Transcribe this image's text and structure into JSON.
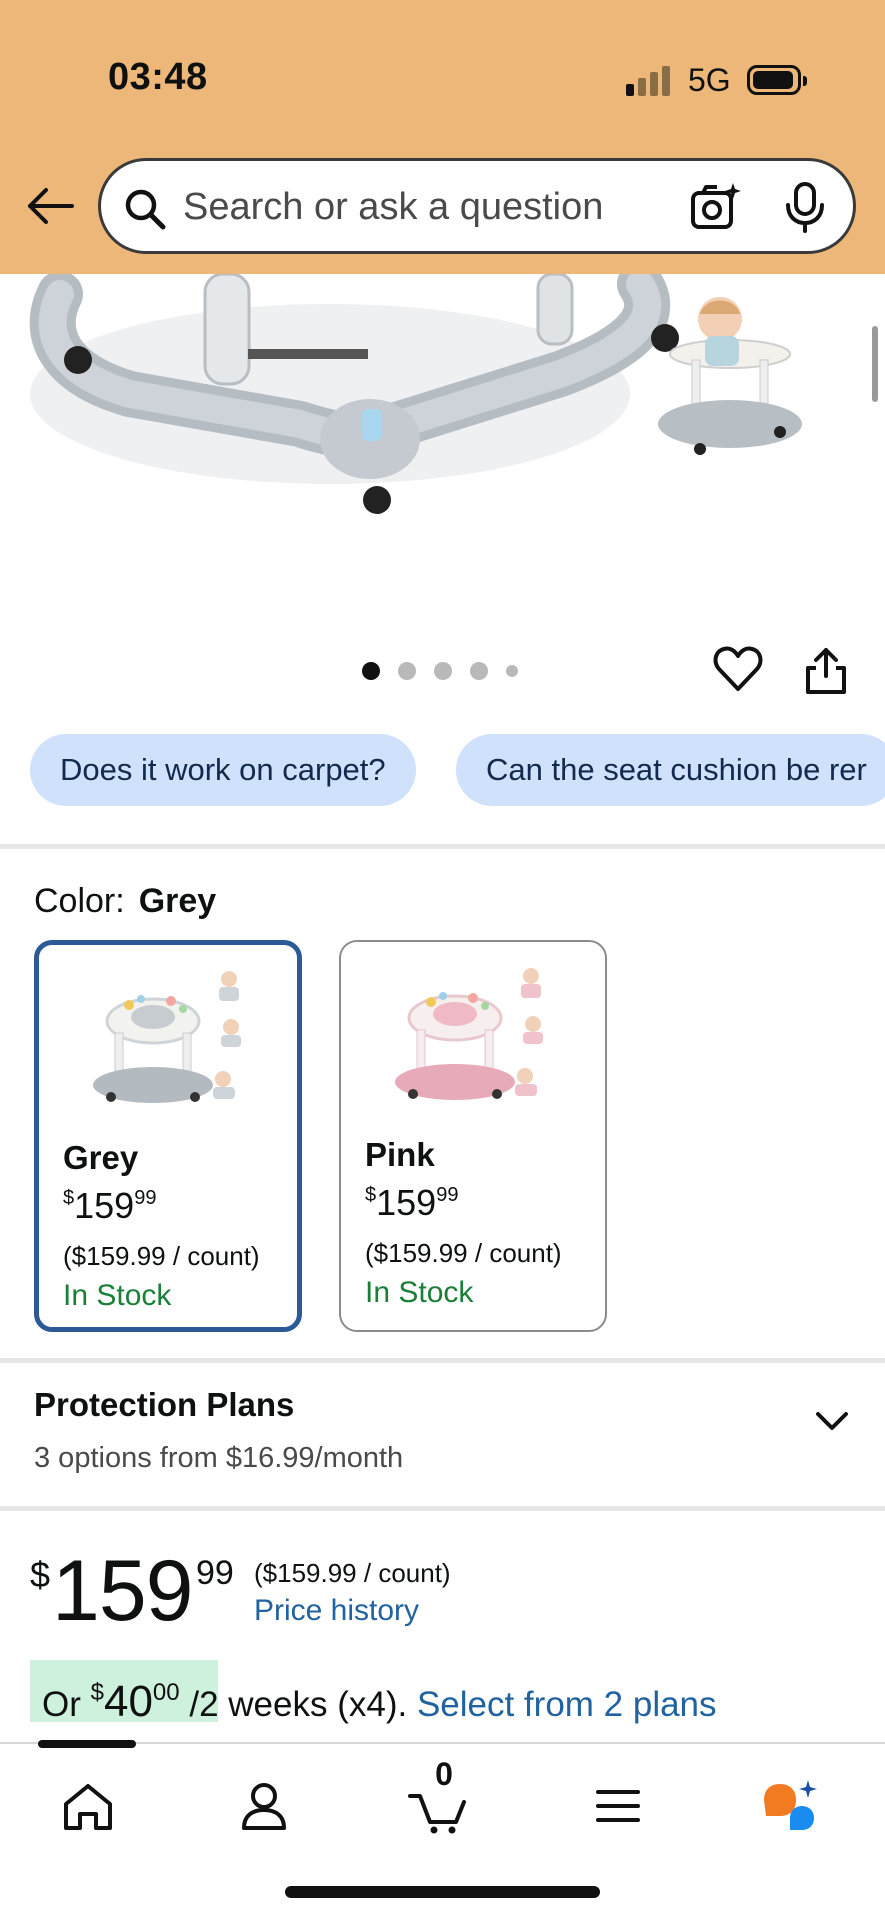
{
  "status_bar": {
    "time": "03:48",
    "network": "5G"
  },
  "search": {
    "placeholder": "Search or ask a question"
  },
  "questions": [
    "Does it work on carpet?",
    "Can the seat cushion be rer"
  ],
  "color": {
    "label": "Color:",
    "selected": "Grey"
  },
  "variants": [
    {
      "name": "Grey",
      "price_symbol": "$",
      "price_whole": "159",
      "price_fraction": "99",
      "unit_price": "($159.99 / count)",
      "stock": "In Stock",
      "selected": true
    },
    {
      "name": "Pink",
      "price_symbol": "$",
      "price_whole": "159",
      "price_fraction": "99",
      "unit_price": "($159.99 / count)",
      "stock": "In Stock",
      "selected": false
    }
  ],
  "protection": {
    "title": "Protection Plans",
    "subtitle": "3 options from $16.99/month"
  },
  "price": {
    "symbol": "$",
    "whole": "159",
    "fraction": "99",
    "unit": "($159.99 / count)",
    "history_link": "Price history"
  },
  "installments": {
    "prefix": "Or ",
    "symbol": "$",
    "whole": "40",
    "fraction": "00",
    "suffix": " /2 weeks (x4).",
    "link": "Select from 2 plans"
  },
  "nav": {
    "cart_count": "0"
  },
  "carousel": {
    "count": 5,
    "active": 0
  },
  "colors": {
    "header_bg": "#ecb779",
    "chip_bg": "#cfe1fb",
    "link": "#2162a1",
    "in_stock": "#1a7f37",
    "selected_border": "#2b5a96",
    "plan_badge": "#cdf1dd"
  }
}
